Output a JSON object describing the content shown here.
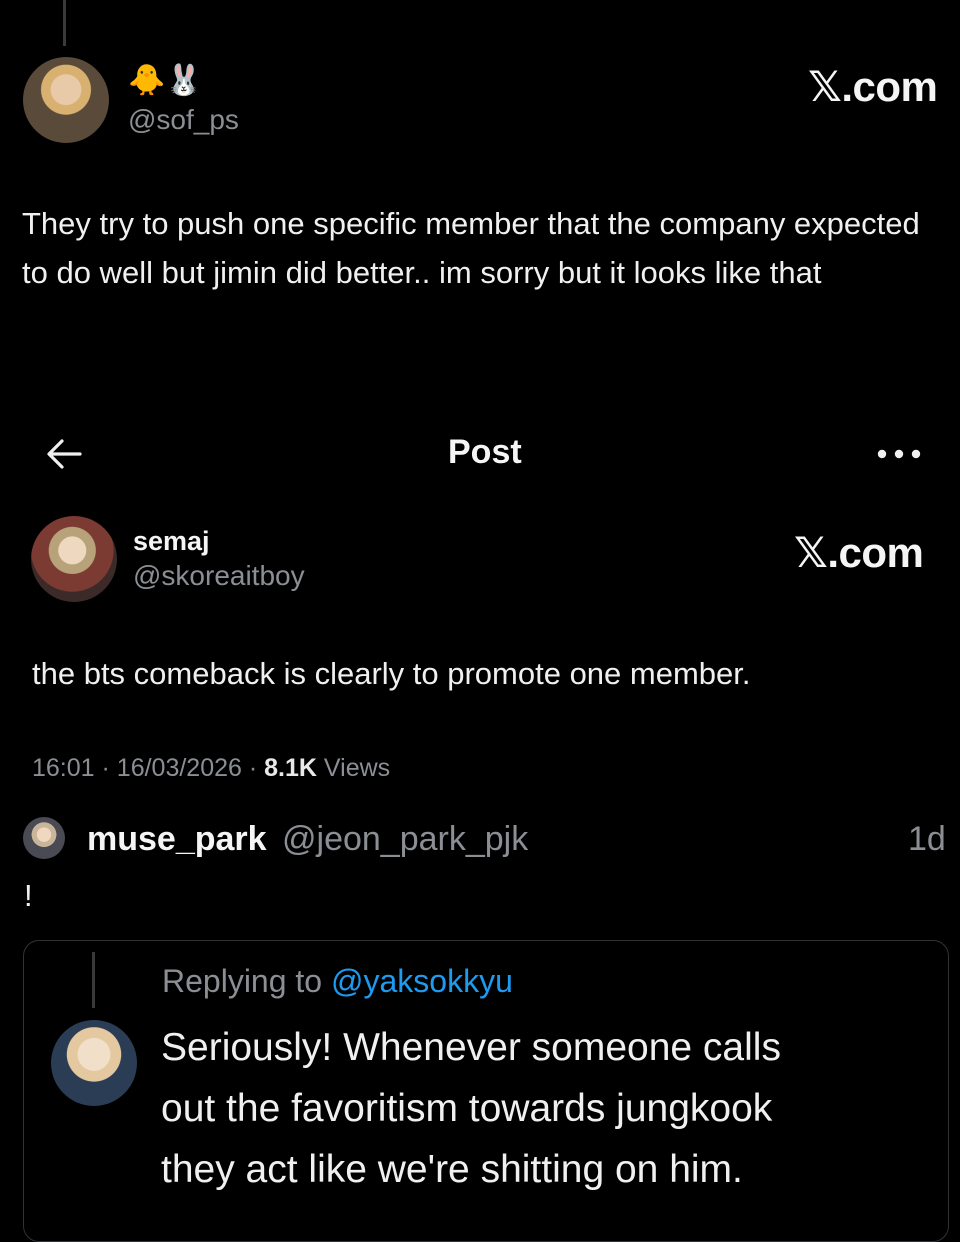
{
  "first_post": {
    "name_emojis": "🐥🐰",
    "handle": "@sof_ps",
    "brand": "𝕏.com",
    "text": "They try to push one specific member that the company expected to do well but jimin did better.. im sorry but it looks like that"
  },
  "header": {
    "back_icon": "←",
    "title": "Post",
    "more_icon": "•••"
  },
  "main_post": {
    "name": "semaj",
    "handle": "@skoreaitboy",
    "brand": "𝕏.com",
    "text": "the bts comeback is clearly to promote one member.",
    "time": "16:01",
    "sep1": "·",
    "date": "16/03/2026",
    "sep2": "·",
    "views_count": "8.1K",
    "views_label": "Views"
  },
  "reply": {
    "name": "muse_park",
    "handle": "@jeon_park_pjk",
    "age": "1d",
    "text": "!",
    "quote": {
      "replying_label": "Replying to",
      "replying_handle": "@yaksokkyu",
      "lines": [
        "Seriously! Whenever someone calls",
        "out the favoritism towards jungkook",
        "they act like we're shitting on him."
      ]
    }
  },
  "colors": {
    "background": "#000000",
    "text": "#e7e9ea",
    "secondary_text": "#8b8f94",
    "link": "#1d9bf0",
    "border": "#2f3336"
  }
}
